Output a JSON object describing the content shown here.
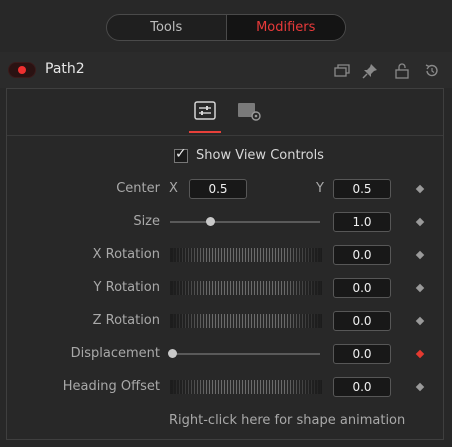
{
  "tabs": {
    "tools": "Tools",
    "modifiers": "Modifiers"
  },
  "node": {
    "name": "Path2"
  },
  "header_icons": [
    "window-icon",
    "pin-icon",
    "lock-icon",
    "reset-icon"
  ],
  "view_controls": {
    "label": "Show View Controls",
    "checked": true
  },
  "center": {
    "label": "Center",
    "x_label": "X",
    "x_value": "0.5",
    "y_label": "Y",
    "y_value": "0.5"
  },
  "size": {
    "label": "Size",
    "value": "1.0",
    "slider_fraction": 0.25
  },
  "x_rotation": {
    "label": "X Rotation",
    "value": "0.0"
  },
  "y_rotation": {
    "label": "Y Rotation",
    "value": "0.0"
  },
  "z_rotation": {
    "label": "Z Rotation",
    "value": "0.0"
  },
  "displacement": {
    "label": "Displacement",
    "value": "0.0",
    "slider_fraction": 0.0,
    "keyframed": true
  },
  "heading_offset": {
    "label": "Heading Offset",
    "value": "0.0"
  },
  "footer": {
    "text": "Right-click here for shape animation"
  },
  "colors": {
    "accent": "#e8403a",
    "active_tab_text": "#e83a3a",
    "background": "#282828"
  }
}
